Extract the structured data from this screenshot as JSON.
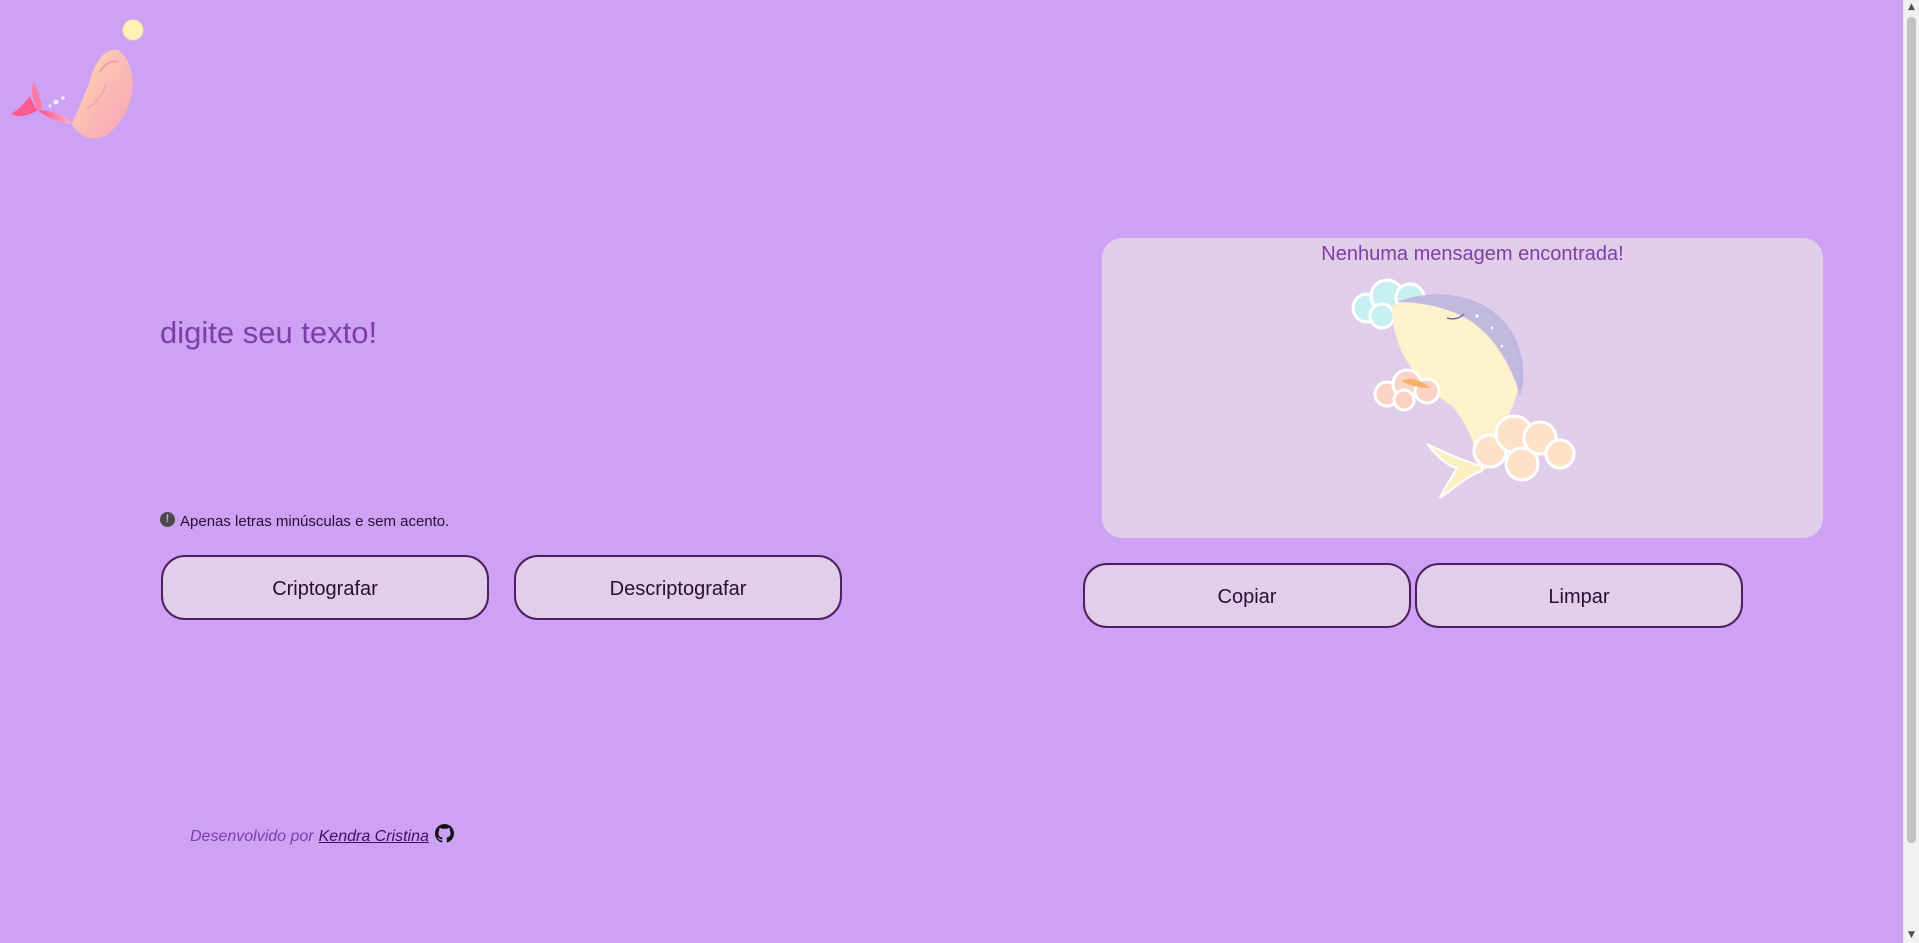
{
  "colors": {
    "background": "#cda2f5",
    "panel": "#e0cdea",
    "accent_text": "#7e3ea6",
    "button_border": "#4e1f5c",
    "dark_text": "#2b0d33"
  },
  "header": {
    "logo_icon": "whale-logo-icon"
  },
  "input": {
    "placeholder": "digite seu texto!",
    "value": ""
  },
  "hint": {
    "icon": "exclamation-circle-icon",
    "text": "Apenas letras minúsculas e sem acento."
  },
  "actions": {
    "encrypt_label": "Criptografar",
    "decrypt_label": "Descriptografar"
  },
  "output": {
    "empty_title": "Nenhuma mensagem encontrada!",
    "illustration_icon": "whale-clouds-illustration",
    "copy_label": "Copiar",
    "clear_label": "Limpar"
  },
  "footer": {
    "prefix": "Desenvolvido por",
    "author": "Kendra Cristina",
    "icon": "github-icon"
  }
}
